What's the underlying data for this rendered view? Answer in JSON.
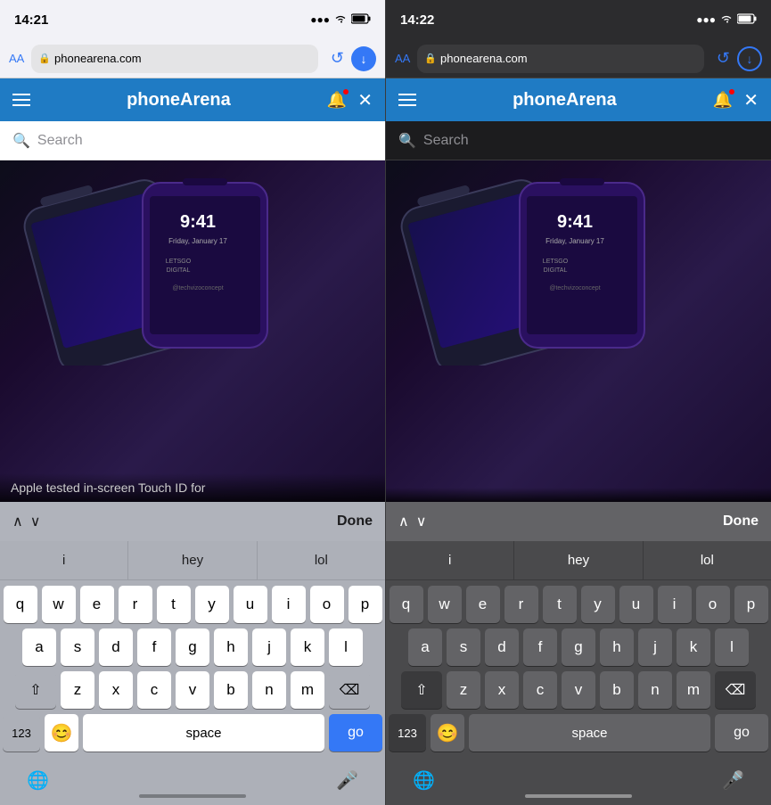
{
  "screens": [
    {
      "id": "screen-left",
      "theme": "light",
      "status": {
        "time": "14:21",
        "signal": "▌▌▌",
        "wifi": "▲",
        "battery": "🔋"
      },
      "safari": {
        "aa": "AA",
        "url": "phonearena.com",
        "refresh_icon": "↺",
        "download_icon": "↓"
      },
      "nav": {
        "title": "phoneArena",
        "bell_icon": "🔔",
        "close_icon": "✕"
      },
      "search": {
        "placeholder": "Search"
      },
      "article": {
        "caption": "Apple tested in-screen Touch ID for"
      },
      "keyboard": {
        "toolbar": {
          "prev_icon": "∧",
          "next_icon": "∨",
          "done_label": "Done"
        },
        "predictive": [
          "i",
          "hey",
          "lol"
        ],
        "rows": [
          [
            "q",
            "w",
            "e",
            "r",
            "t",
            "y",
            "u",
            "i",
            "o",
            "p"
          ],
          [
            "a",
            "s",
            "d",
            "f",
            "g",
            "h",
            "j",
            "k",
            "l"
          ],
          [
            "⇧",
            "z",
            "x",
            "c",
            "v",
            "b",
            "n",
            "m",
            "⌫"
          ],
          [
            "123",
            "😊",
            "space",
            "go"
          ]
        ],
        "bottom": {
          "globe_icon": "🌐",
          "mic_icon": "🎤"
        }
      }
    },
    {
      "id": "screen-right",
      "theme": "dark",
      "status": {
        "time": "14:22",
        "signal": "▌▌▌",
        "wifi": "▲",
        "battery": "🔋"
      },
      "safari": {
        "aa": "AA",
        "url": "phonearena.com",
        "refresh_icon": "↺",
        "download_icon": "↓"
      },
      "nav": {
        "title": "phoneArena",
        "bell_icon": "🔔",
        "close_icon": "✕"
      },
      "search": {
        "placeholder": "Search"
      },
      "article": {
        "caption": ""
      },
      "keyboard": {
        "toolbar": {
          "prev_icon": "∧",
          "next_icon": "∨",
          "done_label": "Done"
        },
        "predictive": [
          "i",
          "hey",
          "lol"
        ],
        "rows": [
          [
            "q",
            "w",
            "e",
            "r",
            "t",
            "y",
            "u",
            "i",
            "o",
            "p"
          ],
          [
            "a",
            "s",
            "d",
            "f",
            "g",
            "h",
            "j",
            "k",
            "l"
          ],
          [
            "⇧",
            "z",
            "x",
            "c",
            "v",
            "b",
            "n",
            "m",
            "⌫"
          ],
          [
            "123",
            "😊",
            "space",
            "go"
          ]
        ],
        "bottom": {
          "globe_icon": "🌐",
          "mic_icon": "🎤"
        }
      }
    }
  ]
}
